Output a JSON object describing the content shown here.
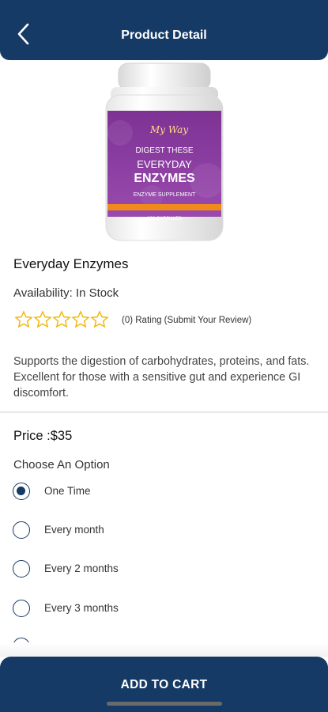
{
  "header": {
    "title": "Product Detail",
    "back_icon": "chevron-left-icon"
  },
  "product": {
    "name": "Everyday Enzymes",
    "availability": "Availability: In Stock",
    "rating_stars": 0,
    "rating_max": 5,
    "rating_text": "(0) Rating (Submit Your Review)",
    "description": "Supports the digestion of carbohydrates, proteins, and fats. Excellent for those with a sensitive gut and experience GI discomfort.",
    "price": "Price  :$35",
    "image_label": {
      "line1": "DIGEST THESE",
      "line2": "EVERYDAY",
      "line3": "ENZYMES",
      "line4": "ENZYME SUPPLEMENT",
      "line5": "200 CAPSULES"
    }
  },
  "options": {
    "title": "Choose An Option",
    "items": [
      {
        "label": "One Time",
        "selected": true
      },
      {
        "label": "Every month",
        "selected": false
      },
      {
        "label": "Every 2 months",
        "selected": false
      },
      {
        "label": "Every 3 months",
        "selected": false
      }
    ]
  },
  "cart": {
    "label": "ADD TO CART"
  },
  "colors": {
    "primary": "#163a66",
    "star": "#f2b500",
    "label_purple": "#8a3a9c",
    "label_orange": "#f08a1c"
  }
}
